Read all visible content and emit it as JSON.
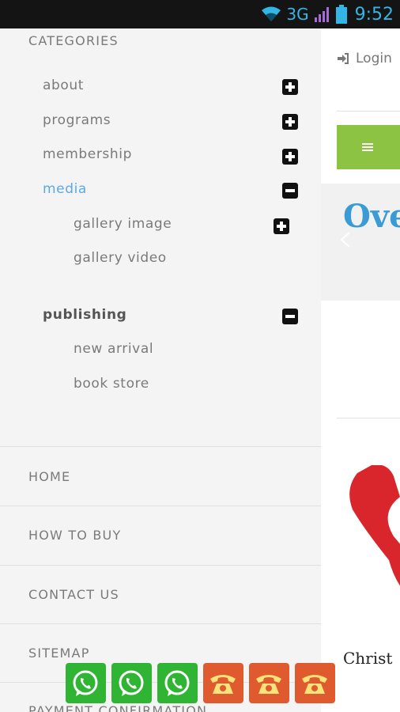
{
  "status_bar": {
    "network": "3G",
    "time": "9:52"
  },
  "page": {
    "login_label": "Login",
    "hero_title": "Ove",
    "footer_text": "Christ"
  },
  "drawer": {
    "categories_title": "CATEGORIES",
    "categories": [
      {
        "label": "about",
        "state": "collapsed"
      },
      {
        "label": "programs",
        "state": "collapsed"
      },
      {
        "label": "membership",
        "state": "collapsed"
      },
      {
        "label": "media",
        "state": "expanded",
        "active": true,
        "children": [
          {
            "label": "gallery image",
            "state": "collapsed"
          },
          {
            "label": "gallery video"
          }
        ]
      },
      {
        "label": "publishing",
        "state": "expanded",
        "children": [
          {
            "label": "new arrival"
          },
          {
            "label": "book store"
          }
        ]
      }
    ],
    "nav_links": [
      "HOME",
      "HOW TO BUY",
      "CONTACT US",
      "SITEMAP",
      "PAYMENT CONFIRMATION"
    ]
  },
  "contact_bar": {
    "buttons": [
      {
        "icon": "whatsapp-icon",
        "color": "#2fb533"
      },
      {
        "icon": "whatsapp-icon",
        "color": "#2fb533"
      },
      {
        "icon": "whatsapp-icon",
        "color": "#2fb533"
      },
      {
        "icon": "phone-icon",
        "color": "#e05a2f"
      },
      {
        "icon": "phone-icon",
        "color": "#e05a2f"
      },
      {
        "icon": "phone-icon",
        "color": "#e05a2f"
      }
    ]
  },
  "colors": {
    "accent_blue": "#5aa9e6",
    "menu_green": "#8dc343",
    "whatsapp_green": "#2fb533",
    "phone_orange": "#e05a2f",
    "status_blue": "#33b5e5"
  }
}
